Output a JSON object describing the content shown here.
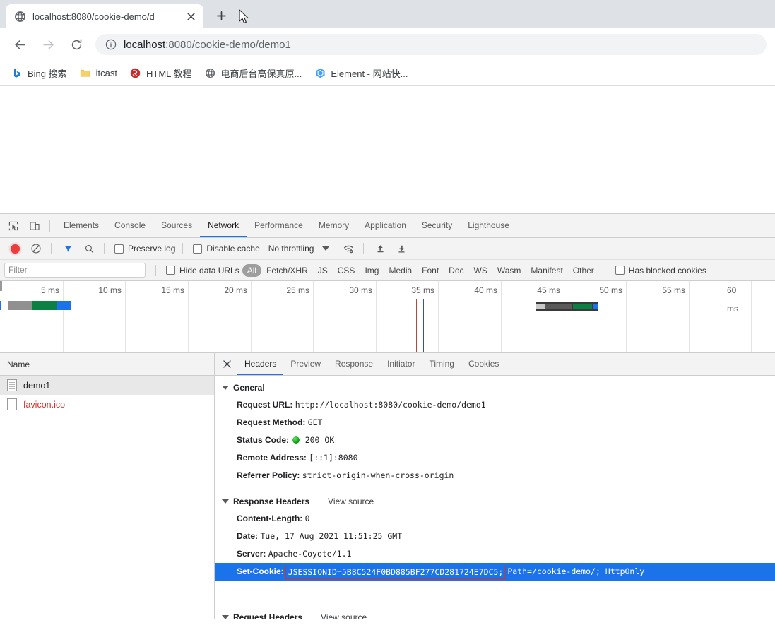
{
  "browser": {
    "tab": {
      "title": "localhost:8080/cookie-demo/d",
      "favicon": "globe-icon",
      "close": "close-icon"
    },
    "new_tab_label": "+",
    "nav": {
      "back": "back-arrow-icon",
      "forward": "forward-arrow-icon",
      "reload": "reload-icon"
    },
    "omnibox": {
      "info_icon": "info-circle-icon",
      "url_host": "localhost",
      "url_rest": ":8080/cookie-demo/demo1",
      "full_url": "localhost:8080/cookie-demo/demo1"
    },
    "bookmarks": [
      {
        "label": "Bing 搜索",
        "icon": "bing-icon"
      },
      {
        "label": "itcast",
        "icon": "folder-icon"
      },
      {
        "label": "HTML 教程",
        "icon": "runoob-icon"
      },
      {
        "label": "电商后台高保真原...",
        "icon": "globe-icon"
      },
      {
        "label": "Element - 网站快...",
        "icon": "element-icon"
      }
    ]
  },
  "devtools": {
    "left_icons": [
      {
        "name": "inspect-element-icon"
      },
      {
        "name": "device-toolbar-icon"
      }
    ],
    "panels": [
      {
        "label": "Elements",
        "active": false
      },
      {
        "label": "Console",
        "active": false
      },
      {
        "label": "Sources",
        "active": false
      },
      {
        "label": "Network",
        "active": true
      },
      {
        "label": "Performance",
        "active": false
      },
      {
        "label": "Memory",
        "active": false
      },
      {
        "label": "Application",
        "active": false
      },
      {
        "label": "Security",
        "active": false
      },
      {
        "label": "Lighthouse",
        "active": false
      }
    ],
    "network_toolbar": {
      "record_icon": "record-button-icon",
      "clear_icon": "clear-icon",
      "filter_icon": "filter-funnel-icon",
      "search_icon": "search-icon",
      "preserve_log_label": "Preserve log",
      "preserve_log_checked": false,
      "disable_cache_label": "Disable cache",
      "disable_cache_checked": false,
      "throttling_label": "No throttling",
      "throttling_caret": "chevron-down-icon",
      "wifi_settings_icon": "network-conditions-icon",
      "import_icon": "import-har-icon",
      "export_icon": "export-har-icon"
    },
    "filter_bar": {
      "filter_placeholder": "Filter",
      "filter_value": "",
      "hide_data_urls_label": "Hide data URLs",
      "hide_data_urls_checked": false,
      "types": [
        {
          "label": "All",
          "active": true
        },
        {
          "label": "Fetch/XHR",
          "active": false
        },
        {
          "label": "JS",
          "active": false
        },
        {
          "label": "CSS",
          "active": false
        },
        {
          "label": "Img",
          "active": false
        },
        {
          "label": "Media",
          "active": false
        },
        {
          "label": "Font",
          "active": false
        },
        {
          "label": "Doc",
          "active": false
        },
        {
          "label": "WS",
          "active": false
        },
        {
          "label": "Wasm",
          "active": false
        },
        {
          "label": "Manifest",
          "active": false
        },
        {
          "label": "Other",
          "active": false
        }
      ],
      "has_blocked_cookies_label": "Has blocked cookies",
      "has_blocked_cookies_checked": false
    },
    "overview": {
      "ticks": [
        "5 ms",
        "10 ms",
        "15 ms",
        "20 ms",
        "25 ms",
        "30 ms",
        "35 ms",
        "40 ms",
        "45 ms",
        "50 ms",
        "55 ms",
        "60 ms"
      ]
    },
    "requests": {
      "column_header": "Name",
      "rows": [
        {
          "name": "demo1",
          "icon": "document-icon",
          "selected": true,
          "error": false
        },
        {
          "name": "favicon.ico",
          "icon": "blank-file-icon",
          "selected": false,
          "error": true
        }
      ]
    },
    "detail": {
      "close_icon": "close-icon",
      "tabs": [
        {
          "label": "Headers",
          "active": true
        },
        {
          "label": "Preview",
          "active": false
        },
        {
          "label": "Response",
          "active": false
        },
        {
          "label": "Initiator",
          "active": false
        },
        {
          "label": "Timing",
          "active": false
        },
        {
          "label": "Cookies",
          "active": false
        }
      ],
      "general": {
        "title": "General",
        "rows": [
          {
            "name": "Request URL:",
            "value": "http://localhost:8080/cookie-demo/demo1"
          },
          {
            "name": "Request Method:",
            "value": "GET"
          },
          {
            "name": "Status Code:",
            "value": "200 OK",
            "status_dot": true
          },
          {
            "name": "Remote Address:",
            "value": "[::1]:8080"
          },
          {
            "name": "Referrer Policy:",
            "value": "strict-origin-when-cross-origin"
          }
        ]
      },
      "response_headers": {
        "title": "Response Headers",
        "view_source": "View source",
        "rows": [
          {
            "name": "Content-Length:",
            "value": "0"
          },
          {
            "name": "Date:",
            "value": "Tue, 17 Aug 2021 11:51:25 GMT"
          },
          {
            "name": "Server:",
            "value": "Apache-Coyote/1.1"
          }
        ],
        "set_cookie": {
          "name": "Set-Cookie:",
          "highlighted_value": "JSESSIONID=5B8C524F0BD885BF277CD281724E7DC5;",
          "rest_value": "Path=/cookie-demo/; HttpOnly"
        }
      },
      "request_headers": {
        "title": "Request Headers",
        "view_source": "View source"
      }
    }
  },
  "colors": {
    "accent": "#1a73e8",
    "highlight_box_border": "#d32f2f",
    "error_text": "#d93025",
    "status_ok": "#12a312",
    "tabbar_bg": "#dee1e6",
    "devtools_bg": "#f3f3f3"
  }
}
